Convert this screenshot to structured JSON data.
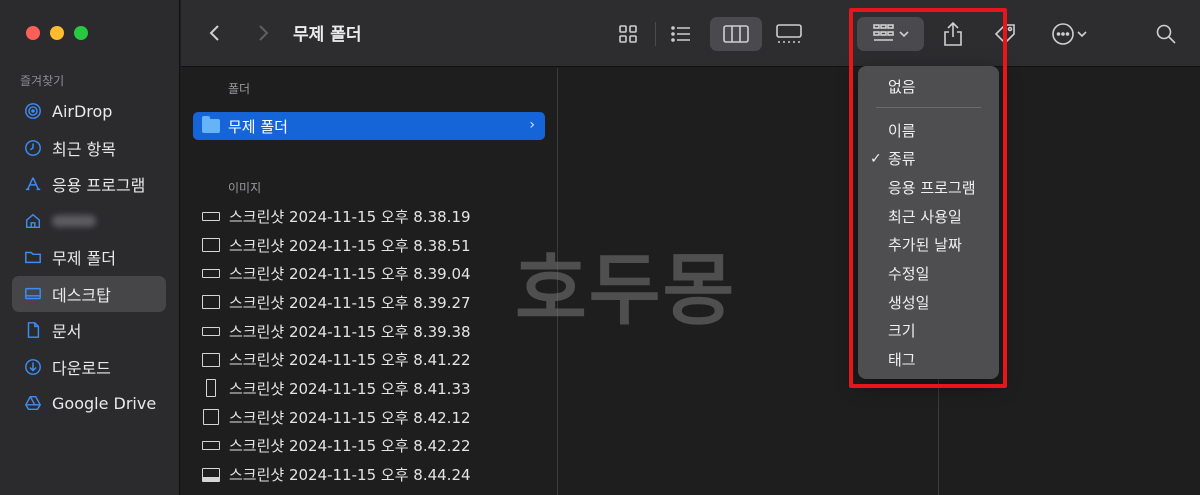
{
  "window": {
    "title": "무제 폴더"
  },
  "sidebar": {
    "section_label": "즐겨찾기",
    "items": [
      {
        "label": "AirDrop",
        "icon": "airdrop-icon"
      },
      {
        "label": "최근 항목",
        "icon": "clock-icon"
      },
      {
        "label": "응용 프로그램",
        "icon": "applications-icon"
      },
      {
        "label": "",
        "icon": "home-icon"
      },
      {
        "label": "무제 폴더",
        "icon": "folder-icon"
      },
      {
        "label": "데스크탑",
        "icon": "desktop-icon"
      },
      {
        "label": "문서",
        "icon": "document-icon"
      },
      {
        "label": "다운로드",
        "icon": "download-icon"
      },
      {
        "label": "Google Drive",
        "icon": "google-drive-icon"
      }
    ]
  },
  "column1": {
    "folders_header": "폴더",
    "selected_folder": "무제 폴더",
    "images_header": "이미지",
    "files": [
      "스크린샷 2024-11-15 오후 8.38.19",
      "스크린샷 2024-11-15 오후 8.38.51",
      "스크린샷 2024-11-15 오후 8.39.04",
      "스크린샷 2024-11-15 오후 8.39.27",
      "스크린샷 2024-11-15 오후 8.39.38",
      "스크린샷 2024-11-15 오후 8.41.22",
      "스크린샷 2024-11-15 오후 8.41.33",
      "스크린샷 2024-11-15 오후 8.42.12",
      "스크린샷 2024-11-15 오후 8.42.22",
      "스크린샷 2024-11-15 오후 8.44.24"
    ]
  },
  "group_menu": {
    "none_label": "없음",
    "items": [
      "이름",
      "종류",
      "응용 프로그램",
      "최근 사용일",
      "추가된 날짜",
      "수정일",
      "생성일",
      "크기",
      "태그"
    ],
    "checked": "종류"
  },
  "watermark": "호두몽",
  "colors": {
    "accent": "#1565d8",
    "sidebar_icon": "#3d8df5",
    "highlight": "#e8161a"
  }
}
